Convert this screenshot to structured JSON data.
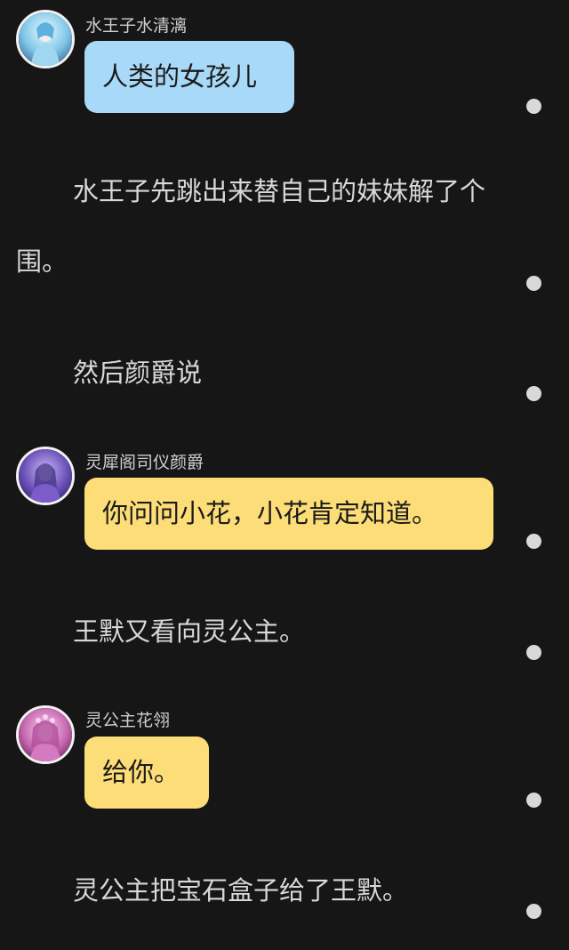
{
  "colors": {
    "background": "#161616",
    "bubble_blue": "#a9d9f8",
    "bubble_yellow": "#fddd77",
    "dot": "#d9d9d9"
  },
  "messages": [
    {
      "type": "dialogue",
      "speaker": "水王子水清漓",
      "text": "人类的女孩儿",
      "bubble_color": "blue",
      "avatar_icon": "water-prince-avatar"
    },
    {
      "type": "narration",
      "text": "水王子先跳出来替自己的妹妹解了个围。"
    },
    {
      "type": "narration",
      "text": "然后颜爵说"
    },
    {
      "type": "dialogue",
      "speaker": "灵犀阁司仪颜爵",
      "text": "你问问小花，小花肯定知道。",
      "bubble_color": "yellow",
      "avatar_icon": "master-of-ceremonies-avatar"
    },
    {
      "type": "narration",
      "text": "王默又看向灵公主。"
    },
    {
      "type": "dialogue",
      "speaker": "灵公主花翎",
      "text": "给你。",
      "bubble_color": "yellow",
      "avatar_icon": "ling-princess-avatar"
    },
    {
      "type": "narration",
      "text": "灵公主把宝石盒子给了王默。"
    }
  ]
}
